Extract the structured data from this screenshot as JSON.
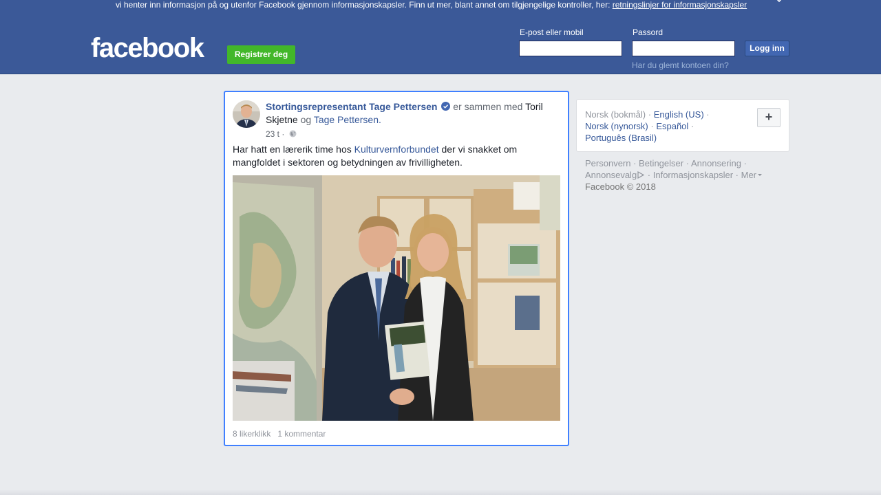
{
  "cookie_bar": {
    "text": "vi henter inn informasjon på og utenfor Facebook gjennom informasjonskapsler. Finn ut mer, blant annet om tilgjengelige kontroller, her: ",
    "link": "retningslinjer for informasjonskapsler"
  },
  "header": {
    "logo": "facebook",
    "register_label": "Registrer deg",
    "email_label": "E-post eller mobil",
    "email_value": "",
    "password_label": "Passord",
    "password_value": "",
    "login_label": "Logg inn",
    "forgot_label": "Har du glemt kontoen din?"
  },
  "post": {
    "author": "Stortingsrepresentant Tage Pettersen",
    "with_text": "er sammen med",
    "tagged_1": "Toril Skjetne",
    "and_text": "og",
    "tagged_2": "Tage Pettersen.",
    "time": "23 t",
    "text_before": "Har hatt en lærerik time hos ",
    "text_link": "Kulturvernforbundet",
    "text_after": " der vi snakket om mangfoldet i sektoren og betydningen av frivilligheten.",
    "likes": "8 likerklikk",
    "comments": "1 kommentar"
  },
  "languages": {
    "current": "Norsk (bokmål)",
    "options": [
      "English (US)",
      "Norsk (nynorsk)",
      "Español",
      "Português (Brasil)"
    ],
    "add_label": "+"
  },
  "footer": {
    "links": [
      "Personvern",
      "Betingelser",
      "Annonsering",
      "Annonsevalg",
      "Informasjonskapsler",
      "Mer"
    ],
    "copyright": "Facebook © 2018"
  },
  "colors": {
    "brand": "#3b5998",
    "link": "#365899",
    "register": "#42b72a",
    "focus": "#4080ff"
  }
}
